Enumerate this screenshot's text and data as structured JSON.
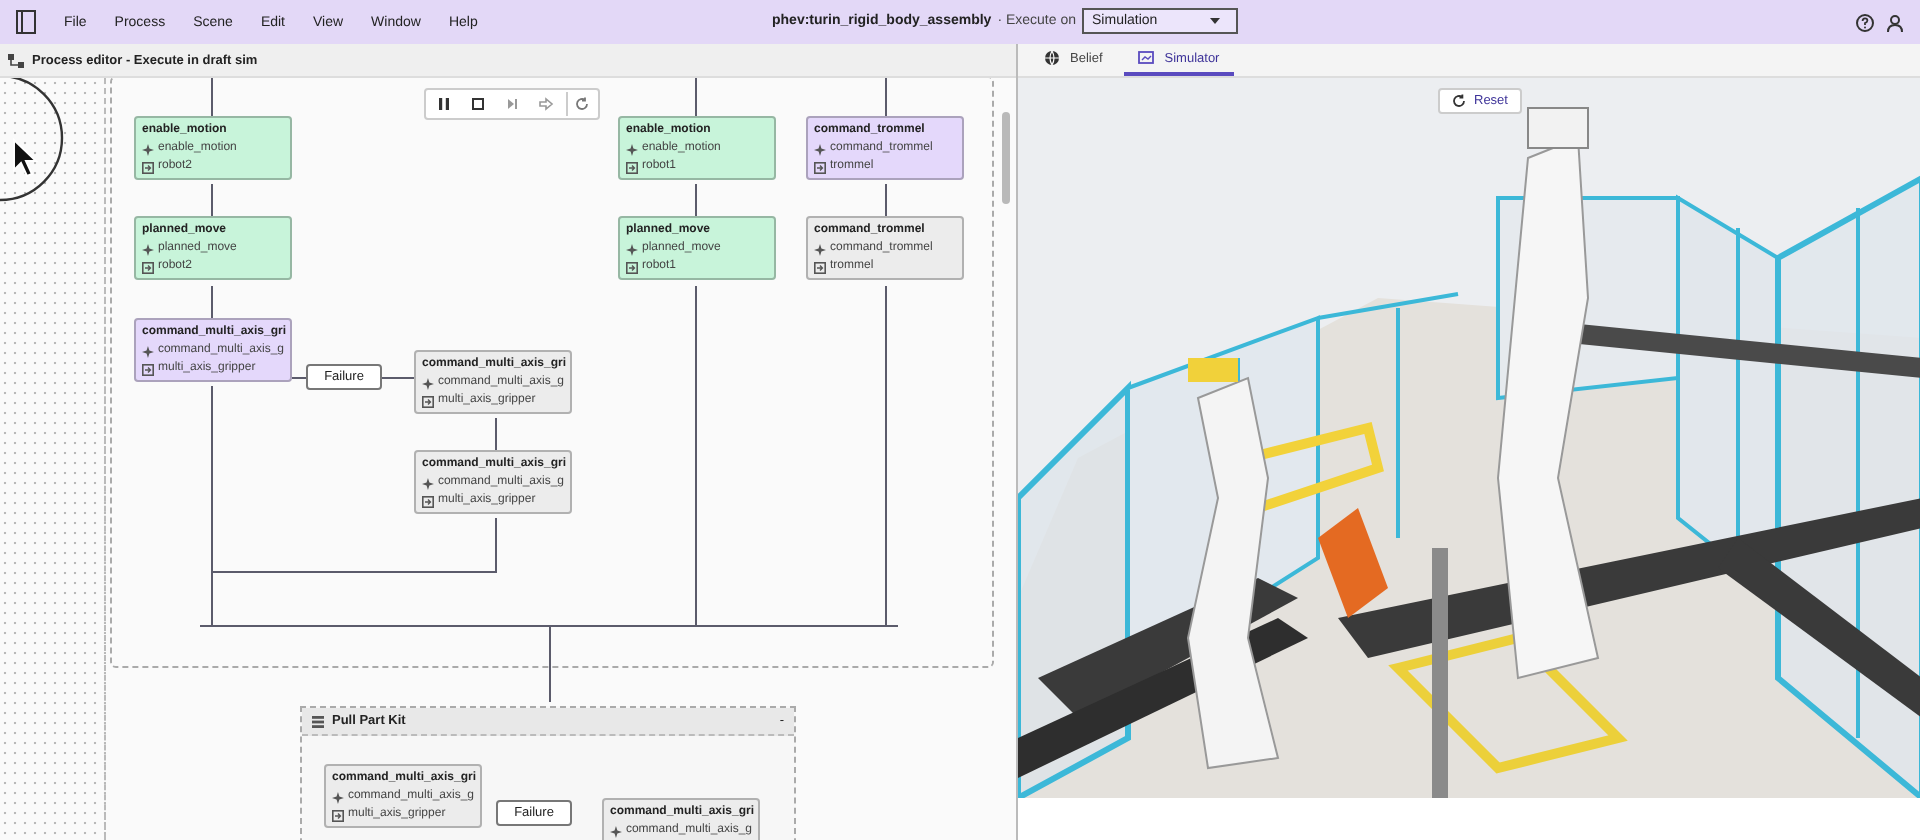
{
  "menu_bar": {
    "items": [
      "File",
      "Process",
      "Scene",
      "Edit",
      "View",
      "Window",
      "Help"
    ]
  },
  "title": {
    "name": "phev:turin_rigid_body_assembly",
    "suffix": "· Execute on",
    "target": "Simulation"
  },
  "process_editor": {
    "title": "Process editor - Execute in draft sim",
    "nodes": [
      {
        "title": "enable_motion",
        "action": "enable_motion",
        "resource": "robot2",
        "color": "#c8f4da"
      },
      {
        "title": "planned_move",
        "action": "planned_move",
        "resource": "robot2",
        "color": "#c8f4da"
      },
      {
        "title": "command_multi_axis_gri",
        "action": "command_multi_axis_g",
        "resource": "multi_axis_gripper",
        "color": "#e4d8fb"
      },
      {
        "title": "command_multi_axis_gri",
        "action": "command_multi_axis_g",
        "resource": "multi_axis_gripper",
        "color": "#ececec"
      },
      {
        "title": "command_multi_axis_gri",
        "action": "command_multi_axis_g",
        "resource": "multi_axis_gripper",
        "color": "#ececec"
      },
      {
        "title": "enable_motion",
        "action": "enable_motion",
        "resource": "robot1",
        "color": "#c8f4da"
      },
      {
        "title": "planned_move",
        "action": "planned_move",
        "resource": "robot1",
        "color": "#c8f4da"
      },
      {
        "title": "command_trommel",
        "action": "command_trommel",
        "resource": "trommel",
        "color": "#e4d8fb"
      },
      {
        "title": "command_trommel",
        "action": "command_trommel",
        "resource": "trommel",
        "color": "#ececec"
      }
    ],
    "branch_labels": [
      "Failure"
    ],
    "sub_group": {
      "title": "Pull Part Kit",
      "collapse": "-",
      "nodes": [
        {
          "title": "command_multi_axis_gri",
          "action": "command_multi_axis_g",
          "resource": "multi_axis_gripper",
          "color": "#ececec"
        },
        {
          "title": "command_multi_axis_gri",
          "action": "command_multi_axis_g",
          "color": "#ececec"
        }
      ],
      "branch_labels": [
        "Failure"
      ]
    }
  },
  "viewer": {
    "tabs": [
      {
        "label": "Belief",
        "kind": "globe",
        "selected": false
      },
      {
        "label": "Simulator",
        "kind": "screen",
        "selected": true
      }
    ],
    "reset_button": "Reset"
  }
}
